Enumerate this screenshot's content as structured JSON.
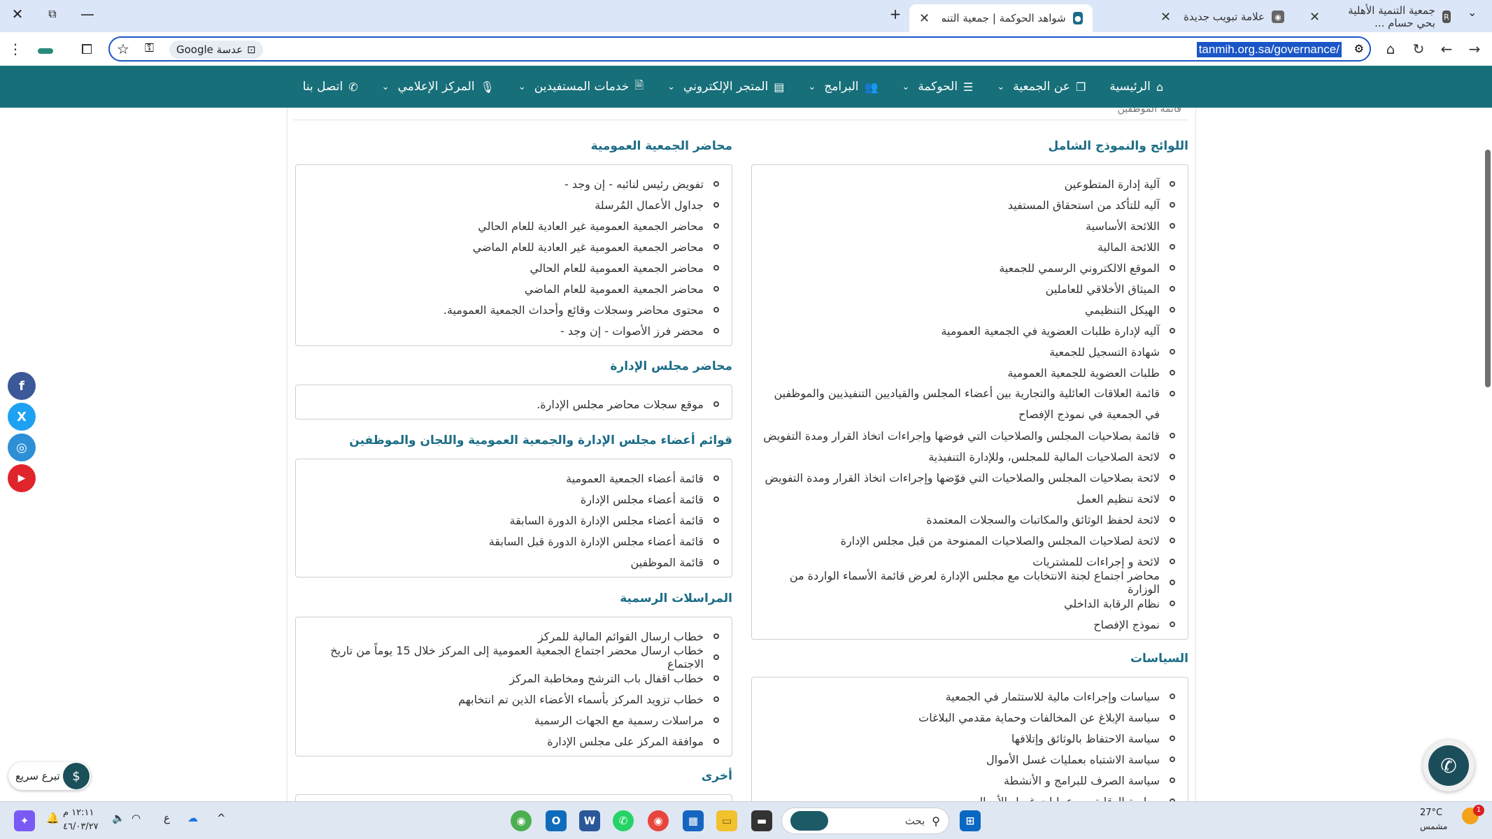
{
  "browser": {
    "tabs": [
      {
        "title": "جمعية التنمية الأهلية بحي حسام ...",
        "favicon_color": "#555555",
        "active": false
      },
      {
        "title": "علامة تبويب جديدة",
        "favicon_color": "#666666",
        "active": false
      },
      {
        "title": "شواهد الحوكمة | جمعية التنمية الأ...",
        "favicon_color": "#1a6c86",
        "active": true
      }
    ],
    "new_tab": "+",
    "address": {
      "url": "tanmih.org.sa/governance/",
      "lens_label": "عدسة Google"
    }
  },
  "navbar": {
    "items": [
      {
        "label": "الرئيسية",
        "icon": "home-icon",
        "has_dropdown": false
      },
      {
        "label": "عن الجمعية",
        "icon": "copy-icon",
        "has_dropdown": true
      },
      {
        "label": "الحوكمة",
        "icon": "list-icon",
        "has_dropdown": true
      },
      {
        "label": "البرامج",
        "icon": "users-icon",
        "has_dropdown": true
      },
      {
        "label": "المتجر الإلكتروني",
        "icon": "card-icon",
        "has_dropdown": true
      },
      {
        "label": "خدمات المستفيدين",
        "icon": "file-icon",
        "has_dropdown": true
      },
      {
        "label": "المركز الإعلامي",
        "icon": "mic-icon",
        "has_dropdown": true
      },
      {
        "label": "اتصل بنا",
        "icon": "phone-icon",
        "has_dropdown": false
      }
    ],
    "bg_color": "#176f79"
  },
  "right_column": {
    "partial_top_text": "قائمة الموظفين",
    "sections": [
      {
        "title": "اللوائح والنموذج الشامل",
        "items": [
          "آلية إدارة المتطوعين",
          "آليه للتأكد من استحقاق المستفيد",
          "اللائحة الأساسية",
          "اللائحة المالية",
          "الموقع الالكتروني الرسمي للجمعية",
          "الميثاق الأخلاقي للعاملين",
          "الهيكل التنظيمي",
          "آليه لإدارة طلبات العضوية في الجمعية العمومية",
          "شهادة التسجيل للجمعية",
          "طلبات العضوية للجمعية العمومية",
          "قائمة العلاقات العائلية والتجارية بين أعضاء المجلس والقياديين التنفيذيين والموظفين في الجمعية في نموذج الإفصاح",
          "قائمة بصلاحيات المجلس والصلاحيات التي فوضها وإجراءات اتخاذ القرار ومدة التفويض",
          "لائحة الصلاحيات المالية للمجلس، وللإدارة التنفيذية",
          "لائحة بصلاحيات المجلس والصلاحيات التي فوّضها وإجراءات اتخاذ القرار ومدة التفويض",
          "لائحة تنظيم العمل",
          "لائحة لحفظ الوثائق والمكاتبات والسجلات المعتمدة",
          "لائحة لصلاحيات المجلس والصلاحيات الممنوحة من قبل مجلس الإدارة",
          "لائحة و إجراءات للمشتريات",
          "محاضر اجتماع لجنة الانتخابات مع مجلس الإدارة لعرض قائمة الأسماء الواردة من الوزارة",
          "نظام الرقابة الداخلي",
          "نموذج الإفصاح"
        ]
      },
      {
        "title": "السياسات",
        "items": [
          "سياسات وإجراءات مالية للاستثمار في الجمعية",
          "سياسة الإبلاغ عن المخالفات وحماية مقدمي البلاغات",
          "سياسة الاحتفاظ بالوثائق وإتلافها",
          "سياسة الاشتباه بعمليات غسل الأموال",
          "سياسة الصرف للبرامج و الأنشطة",
          "سياسة الوقاية من عمليات غسل الأموال"
        ]
      }
    ]
  },
  "left_column": {
    "sections": [
      {
        "title": "محاضر الجمعية العمومية",
        "items": [
          "تفويض رئيس لنائبه - إن وجد -",
          "جداول الأعمال المُرسلة",
          "محاضر الجمعية العمومية غير العادية للعام الحالي",
          "محاضر الجمعية العمومية غير العادية للعام الماضي",
          "محاضر الجمعية العمومية للعام الحالي",
          "محاضر الجمعية العمومية للعام الماضي",
          "محتوى محاضر وسجلات وقائع وأحداث الجمعية العمومية.",
          "محضر فرز الأصوات - إن وجد -"
        ]
      },
      {
        "title": "محاضر مجلس الإدارة",
        "items": [
          "موقع سجلات محاضر مجلس الإدارة."
        ]
      },
      {
        "title": "قوائم أعضاء مجلس الإدارة والجمعية العمومية واللجان والموظفين",
        "items": [
          "قائمة أعضاء الجمعية العمومية",
          "قائمة أعضاء مجلس الإدارة",
          "قائمة أعضاء مجلس الإدارة الدورة السابقة",
          "قائمة أعضاء مجلس الإدارة الدورة قبل السابقة",
          "قائمة الموظفين"
        ]
      },
      {
        "title": "المراسلات الرسمية",
        "items": [
          "خطاب ارسال القوائم المالية للمركز",
          "خطاب ارسال محضر اجتماع الجمعية العمومية إلى المركز خلال 15 يوماً من تاريخ الاجتماع",
          "خطاب اقفال باب الترشح ومخاطبة المركز",
          "خطاب تزويد المركز بأسماء الأعضاء الذين تم انتخابهم",
          "مراسلات رسمية مع الجهات الرسمية",
          "موافقة المركز على مجلس الإدارة"
        ]
      },
      {
        "title": "أخرى",
        "items": []
      }
    ]
  },
  "social": [
    {
      "name": "facebook",
      "glyph": "f",
      "color": "#3b5998"
    },
    {
      "name": "x",
      "glyph": "X",
      "color": "#1da1f2"
    },
    {
      "name": "instagram",
      "glyph": "◎",
      "color": "#2d8fd5"
    },
    {
      "name": "youtube",
      "glyph": "▶",
      "color": "#e0242b"
    }
  ],
  "donate": {
    "label": "تبرع سريع"
  },
  "taskbar": {
    "search_placeholder": "بحث",
    "weather_temp": "27°C",
    "weather_desc": "مشمس",
    "time": "١٢:١١ م",
    "date": "٤٦/٠٣/٢٧",
    "lang": "ع",
    "notification_count": "1"
  }
}
